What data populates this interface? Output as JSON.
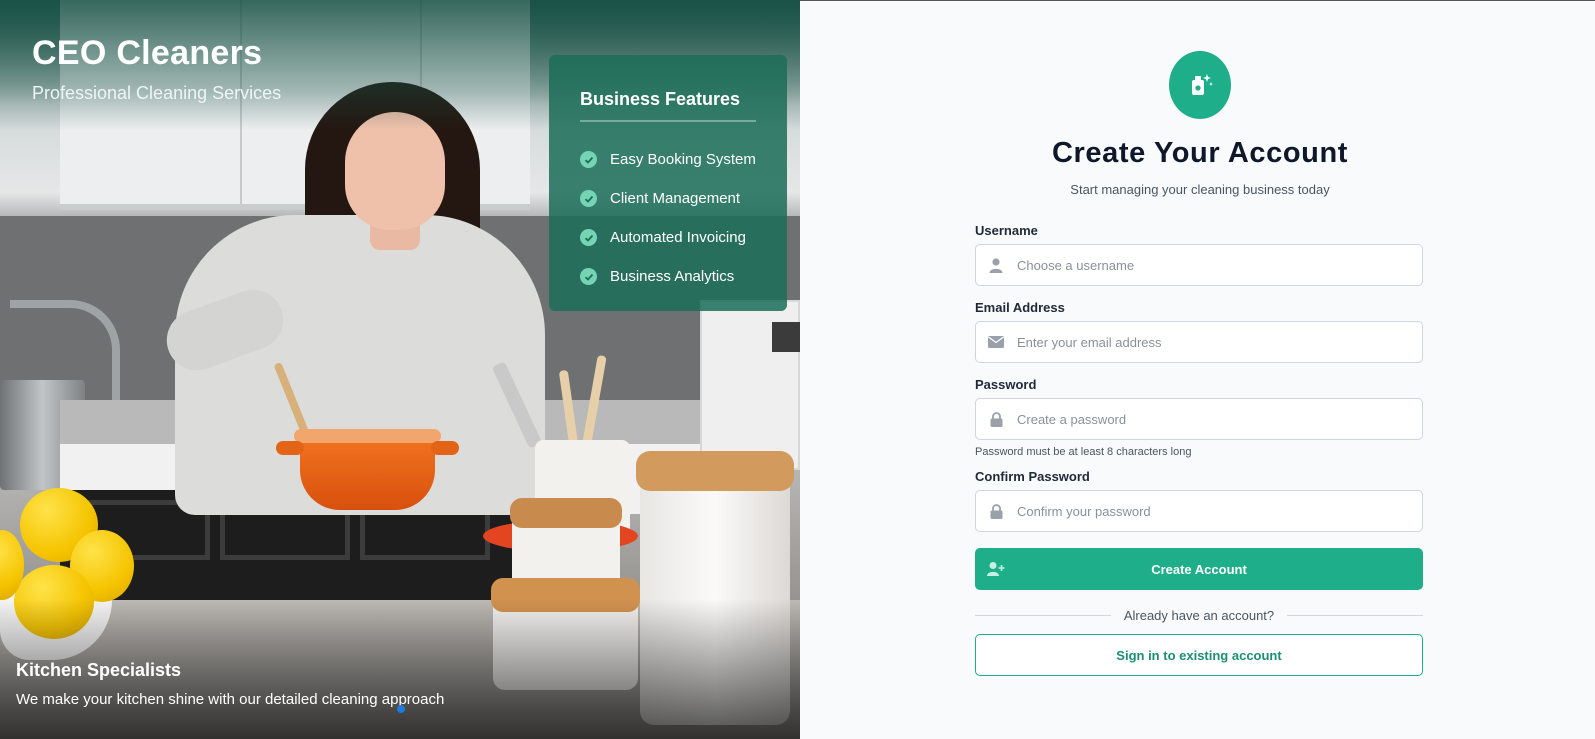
{
  "brand": {
    "name": "CEO Cleaners",
    "tagline": "Professional Cleaning Services"
  },
  "features": {
    "title": "Business Features",
    "items": [
      "Easy Booking System",
      "Client Management",
      "Automated Invoicing",
      "Business Analytics"
    ]
  },
  "specialty": {
    "title": "Kitchen Specialists",
    "description": "We make your kitchen shine with our detailed cleaning approach"
  },
  "form": {
    "logo_icon": "cleaning-spray-sparkle-icon",
    "title": "Create Your Account",
    "subtitle": "Start managing your cleaning business today",
    "username": {
      "label": "Username",
      "placeholder": "Choose a username",
      "value": "",
      "icon": "user-icon"
    },
    "email": {
      "label": "Email Address",
      "placeholder": "Enter your email address",
      "value": "",
      "icon": "envelope-icon"
    },
    "password": {
      "label": "Password",
      "placeholder": "Create a password",
      "value": "",
      "icon": "lock-icon",
      "hint": "Password must be at least 8 characters long"
    },
    "confirm_password": {
      "label": "Confirm Password",
      "placeholder": "Confirm your password",
      "value": "",
      "icon": "lock-icon"
    },
    "submit_label": "Create Account",
    "submit_icon": "user-plus-icon",
    "divider_text": "Already have an account?",
    "signin_label": "Sign in to existing account"
  },
  "colors": {
    "accent": "#1fae8a",
    "feature_card": "#1c6e58",
    "title_text": "#0f172a"
  }
}
